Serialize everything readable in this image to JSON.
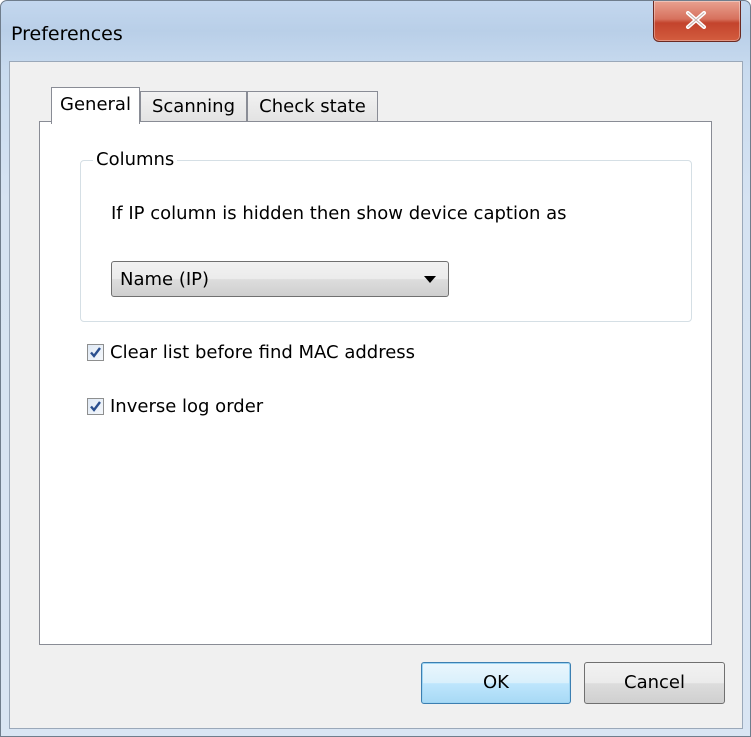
{
  "window": {
    "title": "Preferences"
  },
  "tabs": [
    {
      "label": "General",
      "active": true
    },
    {
      "label": "Scanning",
      "active": false
    },
    {
      "label": "Check state",
      "active": false
    }
  ],
  "columns_group": {
    "label": "Columns",
    "description": "If IP column is hidden then show device caption as",
    "caption_select": {
      "value": "Name (IP)"
    }
  },
  "options": [
    {
      "label": "Clear list before find MAC address",
      "checked": true
    },
    {
      "label": "Inverse log order",
      "checked": true
    }
  ],
  "buttons": {
    "ok": "OK",
    "cancel": "Cancel"
  },
  "colors": {
    "close_button": "#c3432c",
    "checkmark": "#2a4f8f",
    "default_button_border": "#3c7fb1"
  }
}
